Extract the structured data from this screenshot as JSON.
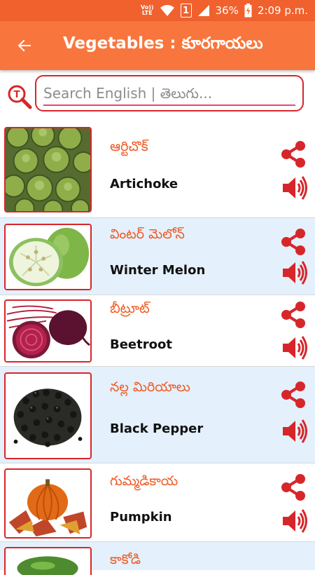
{
  "status_bar": {
    "sim_label_top": "Vo))",
    "sim_label_bottom": "LTE",
    "sim_slot": "1",
    "battery": "36%",
    "time": "2:09 p.m."
  },
  "app_bar": {
    "back_icon": "arrow-left-icon",
    "title": "Vegetables : కూరగాయలు"
  },
  "search": {
    "icon": "telugu-search-icon",
    "placeholder": "Search English | తెలుగు..."
  },
  "colors": {
    "app_bar": "#f8763d",
    "status_bar": "#f0612e",
    "accent_red": "#d7262a",
    "telugu_text": "#ef5a24",
    "alt_row": "#e4f0fb"
  },
  "items": [
    {
      "telugu": "ఆర్టిచొక్",
      "english": "Artichoke",
      "image": "artichoke-image",
      "share_icon": "share-icon",
      "audio_icon": "speaker-icon"
    },
    {
      "telugu": "వింటర్ మెలోన్",
      "english": "Winter Melon",
      "image": "winter-melon-image",
      "share_icon": "share-icon",
      "audio_icon": "speaker-icon"
    },
    {
      "telugu": "బీట్రూట్",
      "english": "Beetroot",
      "image": "beetroot-image",
      "share_icon": "share-icon",
      "audio_icon": "speaker-icon"
    },
    {
      "telugu": "నల్ల మిరియాలు",
      "english": "Black Pepper",
      "image": "black-pepper-image",
      "share_icon": "share-icon",
      "audio_icon": "speaker-icon"
    },
    {
      "telugu": "గుమ్మడికాయ",
      "english": "Pumpkin",
      "image": "pumpkin-image",
      "share_icon": "share-icon",
      "audio_icon": "speaker-icon"
    },
    {
      "telugu": "కాకోడి",
      "english": "",
      "image": "partial-vegetable-image",
      "share_icon": "share-icon",
      "audio_icon": "speaker-icon"
    }
  ]
}
